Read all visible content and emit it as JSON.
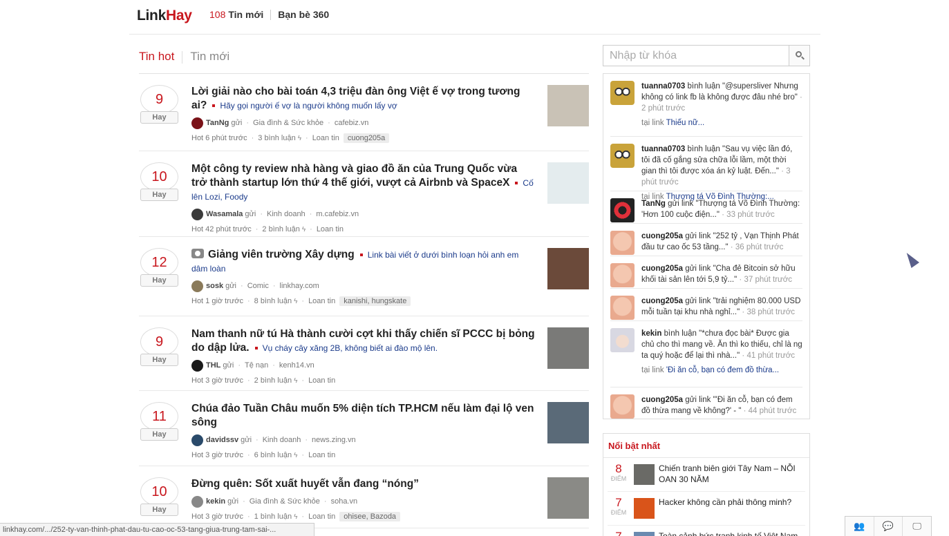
{
  "header": {
    "logo_link": "Link",
    "logo_hay": "Hay",
    "new_count": "108",
    "new_label": "Tin mới",
    "friends_label": "Bạn bè 360"
  },
  "tabs": [
    {
      "label": "Tin hot",
      "active": true
    },
    {
      "label": "Tin mới",
      "active": false
    }
  ],
  "vote_label": "Hay",
  "send_label": "gửi",
  "items": [
    {
      "votes": "9",
      "title": "Lời giải nào cho bài toán 4,3 triệu đàn ông Việt ế vợ trong tương ai?",
      "desc": "Hãy gọi người ế vợ là người không muốn lấy vợ",
      "user": "TanNg",
      "category": "Gia đình & Sức khỏe",
      "source": "cafebiz.vn",
      "time": "Hot 6 phút trước",
      "comments": "3 bình luận",
      "spread": "Loan tin",
      "tags": "cuong205a",
      "avatar_color": "#7a1218",
      "thumb_color": "#c9c2b6"
    },
    {
      "votes": "10",
      "title": "Một công ty review nhà hàng và giao đồ ăn của Trung Quốc vừa trở thành startup lớn thứ 4 thế giới, vượt cả Airbnb và SpaceX",
      "desc": "Cố lên Lozi, Foody",
      "user": "Wasamala",
      "category": "Kinh doanh",
      "source": "m.cafebiz.vn",
      "time": "Hot 42 phút trước",
      "comments": "2 bình luận",
      "spread": "Loan tin",
      "tags": "",
      "avatar_color": "#3b3b3b",
      "thumb_color": "#e4ecee"
    },
    {
      "votes": "12",
      "title": "Giảng viên trường Xây dựng",
      "desc": "Link bài viết ở dưới bình loạn hỏi anh em dâm loàn",
      "user": "sosk",
      "category": "Comic",
      "source": "linkhay.com",
      "time": "Hot 1 giờ trước",
      "comments": "8 bình luận",
      "spread": "Loan tin",
      "tags": "kanishi, hungskate",
      "avatar_color": "#8a7a5a",
      "thumb_color": "#6b4a3a"
    },
    {
      "votes": "9",
      "title": "Nam thanh nữ tú Hà thành cười cợt khi thấy chiến sĩ PCCC bị bỏng do dập lửa.",
      "desc": "Vụ cháy cây xăng 2B, không biết ai đào mộ lên.",
      "user": "THL",
      "category": "Tệ nạn",
      "source": "kenh14.vn",
      "time": "Hot 3 giờ trước",
      "comments": "2 bình luận",
      "spread": "Loan tin",
      "tags": "",
      "avatar_color": "#1a1a1a",
      "thumb_color": "#7a7a78"
    },
    {
      "votes": "11",
      "title": "Chúa đảo Tuần Châu muốn 5% diện tích TP.HCM nếu làm đại lộ ven sông",
      "desc": "",
      "user": "davidssv",
      "category": "Kinh doanh",
      "source": "news.zing.vn",
      "time": "Hot 3 giờ trước",
      "comments": "6 bình luận",
      "spread": "Loan tin",
      "tags": "",
      "avatar_color": "#2a4a6a",
      "thumb_color": "#5a6a78"
    },
    {
      "votes": "10",
      "title": "Đừng quên: Sốt xuất huyết vẫn đang “nóng”",
      "desc": "",
      "user": "kekin",
      "category": "Gia đình & Sức khỏe",
      "source": "soha.vn",
      "time": "Hot 3 giờ trước",
      "comments": "1 bình luận",
      "spread": "Loan tin",
      "tags": "ohisee, Bazoda",
      "avatar_color": "#888888",
      "thumb_color": "#8a8a86"
    }
  ],
  "search": {
    "placeholder": "Nhập từ khóa"
  },
  "activity": [
    {
      "user": "tuanna0703",
      "action": "bình luận",
      "text": "\"@supersliver Nhưng không có link fb là không được đâu nhé bro\"",
      "time": "2 phút trước",
      "link_prefix": "tại link",
      "link": "Thiếu nữ...",
      "avatar": "owl"
    },
    {
      "user": "tuanna0703",
      "action": "bình luận",
      "text": "\"Sau vụ việc lần đó, tôi đã cố gắng sửa chữa lỗi lầm, một thời gian thì tôi được xóa án kỷ luật. Đến...\"",
      "time": "3 phút trước",
      "link_prefix": "tại link",
      "link": "Thượng tá Võ Đình Thường:...",
      "avatar": "owl"
    },
    {
      "user": "TanNg",
      "action": "gửi link",
      "text": "\"Thượng tá Võ Đình Thường: 'Hơn 100 cuộc điện...\"",
      "time": "33 phút trước",
      "link_prefix": "",
      "link": "",
      "avatar": "red"
    },
    {
      "user": "cuong205a",
      "action": "gửi link",
      "text": "\"252 tỷ , Vạn Thịnh Phát đầu tư cao ốc 53 tầng...\"",
      "time": "36 phút trước",
      "link_prefix": "",
      "link": "",
      "avatar": "baby"
    },
    {
      "user": "cuong205a",
      "action": "gửi link",
      "text": "\"Cha đẻ Bitcoin sở hữu khối tài sản lên tới 5,9 tỷ...\"",
      "time": "37 phút trước",
      "link_prefix": "",
      "link": "",
      "avatar": "baby"
    },
    {
      "user": "cuong205a",
      "action": "gửi link",
      "text": "\"trải nghiệm 80.000 USD mỗi tuần tại khu nhà nghỉ...\"",
      "time": "38 phút trước",
      "link_prefix": "",
      "link": "",
      "avatar": "baby"
    },
    {
      "user": "kekin",
      "action": "bình luận",
      "text": "\"*chưa đọc bài* Được gia chủ cho thì mang về. Ăn thì ko thiếu, chỉ là ng ta quý hoặc để lại thì nhà...\"",
      "time": "41 phút trước",
      "link_prefix": "tại link",
      "link": "'Đi ăn cỗ, bạn có đem đồ thừa...",
      "avatar": "girl"
    },
    {
      "user": "cuong205a",
      "action": "gửi link",
      "text": "\"'Đi ăn cỗ, bạn có đem đồ thừa mang về không?' - \"",
      "time": "44 phút trước",
      "link_prefix": "",
      "link": "",
      "avatar": "baby"
    }
  ],
  "featured": {
    "heading": "Nổi bật nhất",
    "score_label": "ĐIỂM",
    "items": [
      {
        "score": "8",
        "title": "Chiến tranh biên giới Tây Nam – NỖI OAN 30 NĂM",
        "color": "#6a6a66"
      },
      {
        "score": "7",
        "title": "Hacker không cần phải thông minh?",
        "color": "#d9541a"
      },
      {
        "score": "7",
        "title": "Toàn cảnh bức tranh kinh tế Việt Nam",
        "color": "#6a8ab0"
      }
    ]
  },
  "statusbar": "linkhay.com/.../252-ty-van-thinh-phat-dau-tu-cao-oc-53-tang-giua-trung-tam-sai-..."
}
